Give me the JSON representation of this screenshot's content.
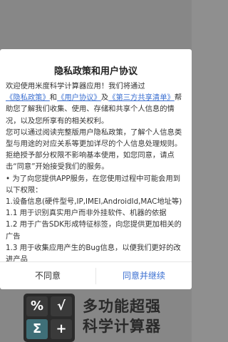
{
  "promo": {
    "line1": "多功能超强",
    "line2": "科学计算器",
    "keys": [
      "%",
      "√",
      "Σ",
      "+"
    ]
  },
  "dialog": {
    "title": "隐私政策和用户协议",
    "intro_before": "欢迎使用米度科学计算器应用！我们将通过",
    "link_privacy": "《隐私政策》",
    "intro_and": "和",
    "link_terms": "《用户协议》",
    "intro_and2": "及",
    "link_thirdparty": "《第三方共享清单》",
    "intro_after": "帮助您了解我们收集、使用、存储和共享个人信息的情况，以及您所享有的相关权利。",
    "para2": "您可以通过阅读完整版用户隐私政策，了解个人信息类型与用途的对应关系等更加详尽的个人信息处理规则。拒绝授予部分权限不影响基本使用，如您同意，请点击“同意”开始接受我们的服务。",
    "para3": "• 为了向您提供APP服务，在您使用过程中可能会用到以下权限：",
    "item1": "1.设备信息(硬件型号,IP,IMEI,AndroidId,MAC地址等)",
    "item1_1": "1.1 用于识别真实用户而非外挂软件、机器的依据",
    "item1_2": "1.2 用于广告SDK形成特征标签，向您提供更加相关的广告",
    "item1_3": "1.3 用于收集应用产生的Bug信息，以便我们更好的改进产品",
    "btn_disagree": "不同意",
    "btn_agree": "同意并继续"
  }
}
